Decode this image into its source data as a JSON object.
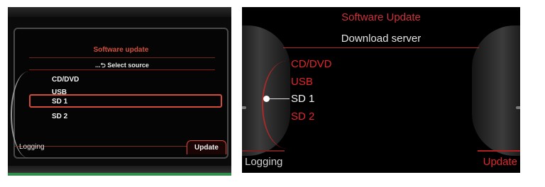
{
  "left_screen": {
    "title": "Software update",
    "subtitle": "...⮌ Select source",
    "items": [
      {
        "label": "CD/DVD"
      },
      {
        "label": "USB"
      },
      {
        "label": "SD 1"
      },
      {
        "label": "SD 2"
      }
    ],
    "selected_index": 2,
    "footer": {
      "left": "Logging",
      "right": "Update"
    }
  },
  "right_screen": {
    "title": "Software Update",
    "header": "Download server",
    "items": [
      {
        "label": "CD/DVD"
      },
      {
        "label": "USB"
      },
      {
        "label": "SD 1"
      },
      {
        "label": "SD 2"
      }
    ],
    "selected_index": 2,
    "footer": {
      "left": "Logging",
      "right": "Update"
    }
  },
  "colors": {
    "accent_red": "#e3252c",
    "title_red": "#d0303a",
    "selected_text": "#f2f2f2"
  }
}
